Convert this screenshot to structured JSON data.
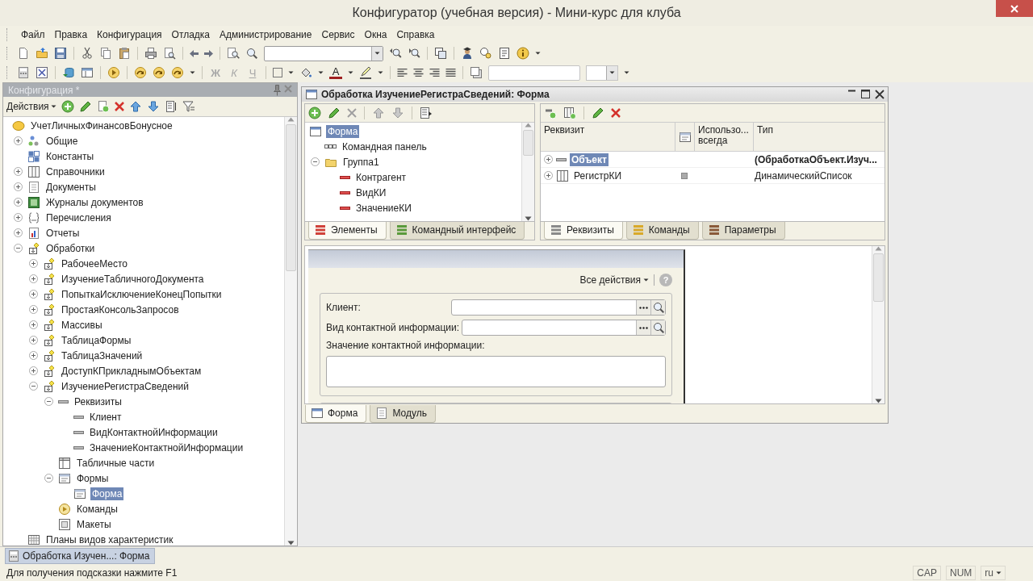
{
  "window": {
    "title": "Конфигуратор (учебная версия) - Мини-курс для клуба"
  },
  "menu": [
    "Файл",
    "Правка",
    "Конфигурация",
    "Отладка",
    "Администрирование",
    "Сервис",
    "Окна",
    "Справка"
  ],
  "format_buttons": [
    {
      "label": "Ж",
      "kind": "bold",
      "disabled": true
    },
    {
      "label": "К",
      "kind": "italic",
      "disabled": true
    },
    {
      "label": "Ч",
      "kind": "underline",
      "disabled": true
    },
    {
      "label": "A",
      "kind": "color",
      "disabled": false
    }
  ],
  "config": {
    "title": "Конфигурация *",
    "actions": "Действия",
    "tree": [
      {
        "label": "УчетЛичныхФинансовБонусное",
        "kind": "configuration",
        "selected": false,
        "children": [
          {
            "label": "Общие",
            "kind": "common",
            "expanded": false,
            "selected": false
          },
          {
            "label": "Константы",
            "kind": "constants",
            "selected": false
          },
          {
            "label": "Справочники",
            "kind": "catalogs",
            "expanded": false,
            "selected": false
          },
          {
            "label": "Документы",
            "kind": "documents",
            "expanded": false,
            "selected": false
          },
          {
            "label": "Журналы документов",
            "kind": "journals",
            "expanded": false,
            "selected": false
          },
          {
            "label": "Перечисления",
            "kind": "enums",
            "expanded": false,
            "selected": false
          },
          {
            "label": "Отчеты",
            "kind": "reports",
            "expanded": false,
            "selected": false
          },
          {
            "label": "Обработки",
            "kind": "processing",
            "expanded": true,
            "selected": false,
            "children": [
              {
                "label": "РабочееМесто",
                "kind": "processing",
                "expanded": false,
                "selected": false
              },
              {
                "label": "ИзучениеТабличногоДокумента",
                "kind": "processing",
                "expanded": false,
                "selected": false
              },
              {
                "label": "ПопыткаИсключениеКонецПопытки",
                "kind": "processing",
                "expanded": false,
                "selected": false
              },
              {
                "label": "ПростаяКонсольЗапросов",
                "kind": "processing",
                "expanded": false,
                "selected": false
              },
              {
                "label": "Массивы",
                "kind": "processing",
                "expanded": false,
                "selected": false
              },
              {
                "label": "ТаблицаФормы",
                "kind": "processing",
                "expanded": false,
                "selected": false
              },
              {
                "label": "ТаблицаЗначений",
                "kind": "processing",
                "expanded": false,
                "selected": false
              },
              {
                "label": "ДоступКПрикладнымОбъектам",
                "kind": "processing",
                "expanded": false,
                "selected": false
              },
              {
                "label": "ИзучениеРегистраСведений",
                "kind": "processing",
                "expanded": true,
                "selected": false,
                "children": [
                  {
                    "label": "Реквизиты",
                    "kind": "attribute",
                    "expanded": true,
                    "selected": false,
                    "children": [
                      {
                        "label": "Клиент",
                        "kind": "attribute",
                        "selected": false
                      },
                      {
                        "label": "ВидКонтактнойИнформации",
                        "kind": "attribute",
                        "selected": false
                      },
                      {
                        "label": "ЗначениеКонтактнойИнформации",
                        "kind": "attribute",
                        "selected": false
                      }
                    ]
                  },
                  {
                    "label": "Табличные части",
                    "kind": "tabular",
                    "selected": false
                  },
                  {
                    "label": "Формы",
                    "kind": "forms",
                    "expanded": true,
                    "selected": false,
                    "children": [
                      {
                        "label": "Форма",
                        "kind": "forms",
                        "selected": true
                      }
                    ]
                  },
                  {
                    "label": "Команды",
                    "kind": "commands",
                    "selected": false
                  },
                  {
                    "label": "Макеты",
                    "kind": "templates",
                    "selected": false
                  }
                ]
              }
            ]
          },
          {
            "label": "Планы видов характеристик",
            "kind": "characteristic_types",
            "selected": false
          }
        ]
      }
    ]
  },
  "form_window": {
    "title": "Обработка ИзучениеРегистраСведений: Форма",
    "elements": [
      {
        "label": "Форма",
        "kind": "form",
        "selected": true,
        "children": [
          {
            "label": "Командная панель",
            "kind": "command_bar",
            "selected": false
          },
          {
            "label": "Группа1",
            "kind": "group",
            "expanded": true,
            "selected": false,
            "children": [
              {
                "label": "Контрагент",
                "kind": "field",
                "selected": false
              },
              {
                "label": "ВидКИ",
                "kind": "field",
                "selected": false
              },
              {
                "label": "ЗначениеКИ",
                "kind": "field",
                "selected": false
              }
            ]
          }
        ]
      }
    ],
    "element_tabs": [
      {
        "label": "Элементы",
        "selected": true
      },
      {
        "label": "Командный интерфейс",
        "selected": false
      }
    ],
    "attribute_columns": [
      "Реквизит",
      "Использо...\nвсегда",
      "Тип"
    ],
    "attributes": [
      {
        "name": "Объект",
        "kind": "object",
        "expanded": false,
        "selected": true,
        "main": true,
        "marked": false,
        "type": "(ОбработкаОбъект.Изуч..."
      },
      {
        "name": "РегистрКИ",
        "kind": "table",
        "expanded": false,
        "selected": false,
        "main": false,
        "marked": true,
        "type": "ДинамическийСписок"
      }
    ],
    "attribute_tabs": [
      {
        "label": "Реквизиты",
        "selected": true
      },
      {
        "label": "Команды",
        "selected": false
      },
      {
        "label": "Параметры",
        "selected": false
      }
    ],
    "preview": {
      "all_actions": "Все действия",
      "help": "?",
      "fields": [
        {
          "label": "Клиент:",
          "kind": "choice"
        },
        {
          "label": "Вид контактной информации:",
          "kind": "choice"
        },
        {
          "label": "Значение контактной информации:",
          "kind": "text_area"
        }
      ]
    },
    "editor_tabs": [
      {
        "label": "Форма",
        "selected": true
      },
      {
        "label": "Модуль",
        "selected": false
      }
    ]
  },
  "open_windows": [
    {
      "label": "Обработка Изучен...: Форма",
      "selected": true
    }
  ],
  "status_bar": {
    "hint": "Для получения подсказки нажмите F1",
    "indicators": [
      "CAP",
      "NUM"
    ],
    "language": "ru"
  }
}
